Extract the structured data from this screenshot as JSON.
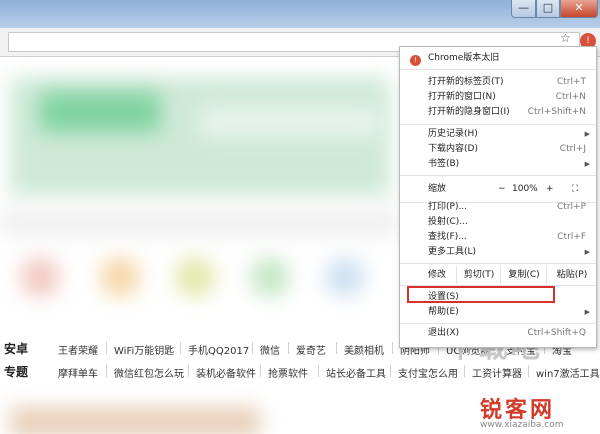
{
  "window": {
    "minimize": "—",
    "maximize": "□",
    "close": "✕"
  },
  "toolbar": {
    "star_icon": "☆",
    "menu_icon": "!"
  },
  "menu": {
    "update": "Chrome版本太旧",
    "new_tab": "打开新的标签页(T)",
    "new_tab_sc": "Ctrl+T",
    "new_window": "打开新的窗口(N)",
    "new_window_sc": "Ctrl+N",
    "incognito": "打开新的隐身窗口(I)",
    "incognito_sc": "Ctrl+Shift+N",
    "history": "历史记录(H)",
    "downloads": "下载内容(D)",
    "downloads_sc": "Ctrl+J",
    "bookmarks": "书签(B)",
    "zoom_label": "缩放",
    "zoom_minus": "−",
    "zoom_value": "100%",
    "zoom_plus": "+",
    "fullscreen": "⛶",
    "print": "打印(P)...",
    "print_sc": "Ctrl+P",
    "cast": "投射(C)...",
    "find": "查找(F)...",
    "find_sc": "Ctrl+F",
    "more_tools": "更多工具(L)",
    "edit_label": "修改",
    "cut": "剪切(T)",
    "copy": "复制(C)",
    "paste": "粘贴(P)",
    "settings": "设置(S)",
    "help": "帮助(E)",
    "exit": "退出(X)",
    "exit_sc": "Ctrl+Shift+Q"
  },
  "categories": {
    "android_head": "安卓",
    "android_items": [
      "王者荣耀",
      "WiFi万能钥匙",
      "手机QQ2017",
      "微信",
      "爱奇艺",
      "美颜相机",
      "阴阳师",
      "UC浏览器",
      "支付宝",
      "淘宝"
    ],
    "topic_head": "专题",
    "topic_items": [
      "摩拜单车",
      "微信红包怎么玩",
      "装机必备软件",
      "抢票软件",
      "站长必备工具",
      "支付宝怎么用",
      "工资计算器",
      "win7激活工具"
    ]
  },
  "watermark": {
    "logo": "下载吧",
    "brand": "锐客网",
    "url": "www.xiazaiba.com"
  },
  "colors": {
    "accent_red": "#d8302a",
    "update_red": "#d8523b"
  }
}
